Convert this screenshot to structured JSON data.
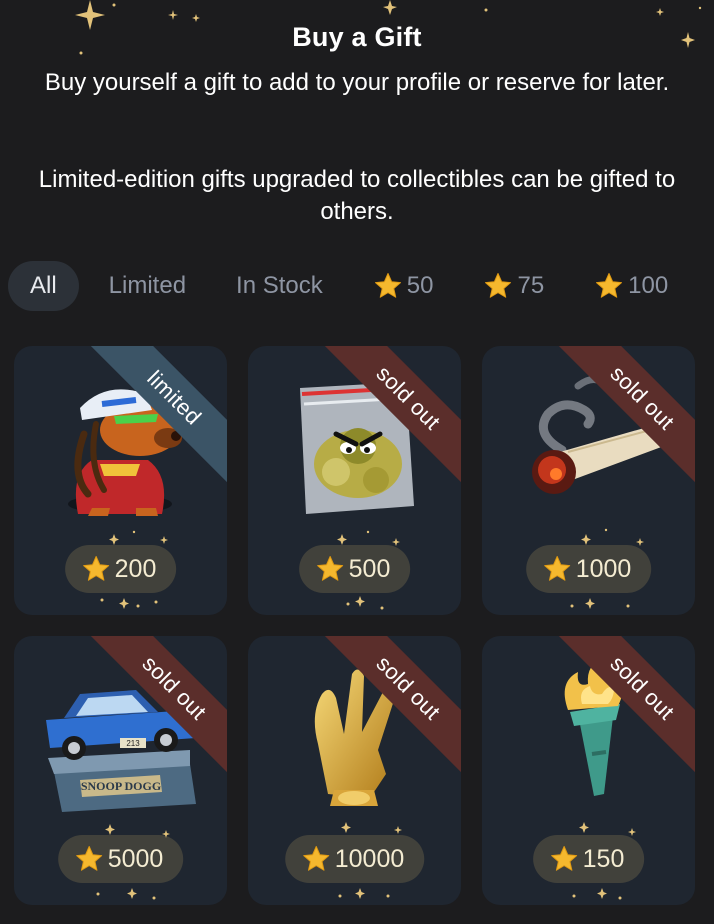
{
  "header": {
    "title": "Buy a Gift",
    "description_1": "Buy yourself a gift to add to your profile or reserve for later.",
    "description_2": "Limited-edition gifts upgraded to collectibles can be gifted to others."
  },
  "filters": [
    {
      "label": "All",
      "active": true,
      "star": false
    },
    {
      "label": "Limited",
      "active": false,
      "star": false
    },
    {
      "label": "In Stock",
      "active": false,
      "star": false
    },
    {
      "label": "50",
      "active": false,
      "star": true
    },
    {
      "label": "75",
      "active": false,
      "star": true
    },
    {
      "label": "100",
      "active": false,
      "star": true
    }
  ],
  "gifts": [
    {
      "badge": "limited",
      "price": "200",
      "art": "dog-rapper-icon"
    },
    {
      "badge": "sold out",
      "price": "500",
      "art": "bag-icon"
    },
    {
      "badge": "sold out",
      "price": "1000",
      "art": "joint-icon"
    },
    {
      "badge": "sold out",
      "price": "5000",
      "art": "lowrider-car-icon",
      "plaque": "SNOOP DOGG",
      "plate": "213"
    },
    {
      "badge": "sold out",
      "price": "10000",
      "art": "gold-hand-icon"
    },
    {
      "badge": "sold out",
      "price": "150",
      "art": "torch-icon"
    }
  ],
  "colors": {
    "background": "#1c1c1e",
    "card": "#1f2630",
    "ribbon_limited": "#3b5466",
    "ribbon_soldout": "#5b2e2b",
    "star": "#f5b82e"
  }
}
